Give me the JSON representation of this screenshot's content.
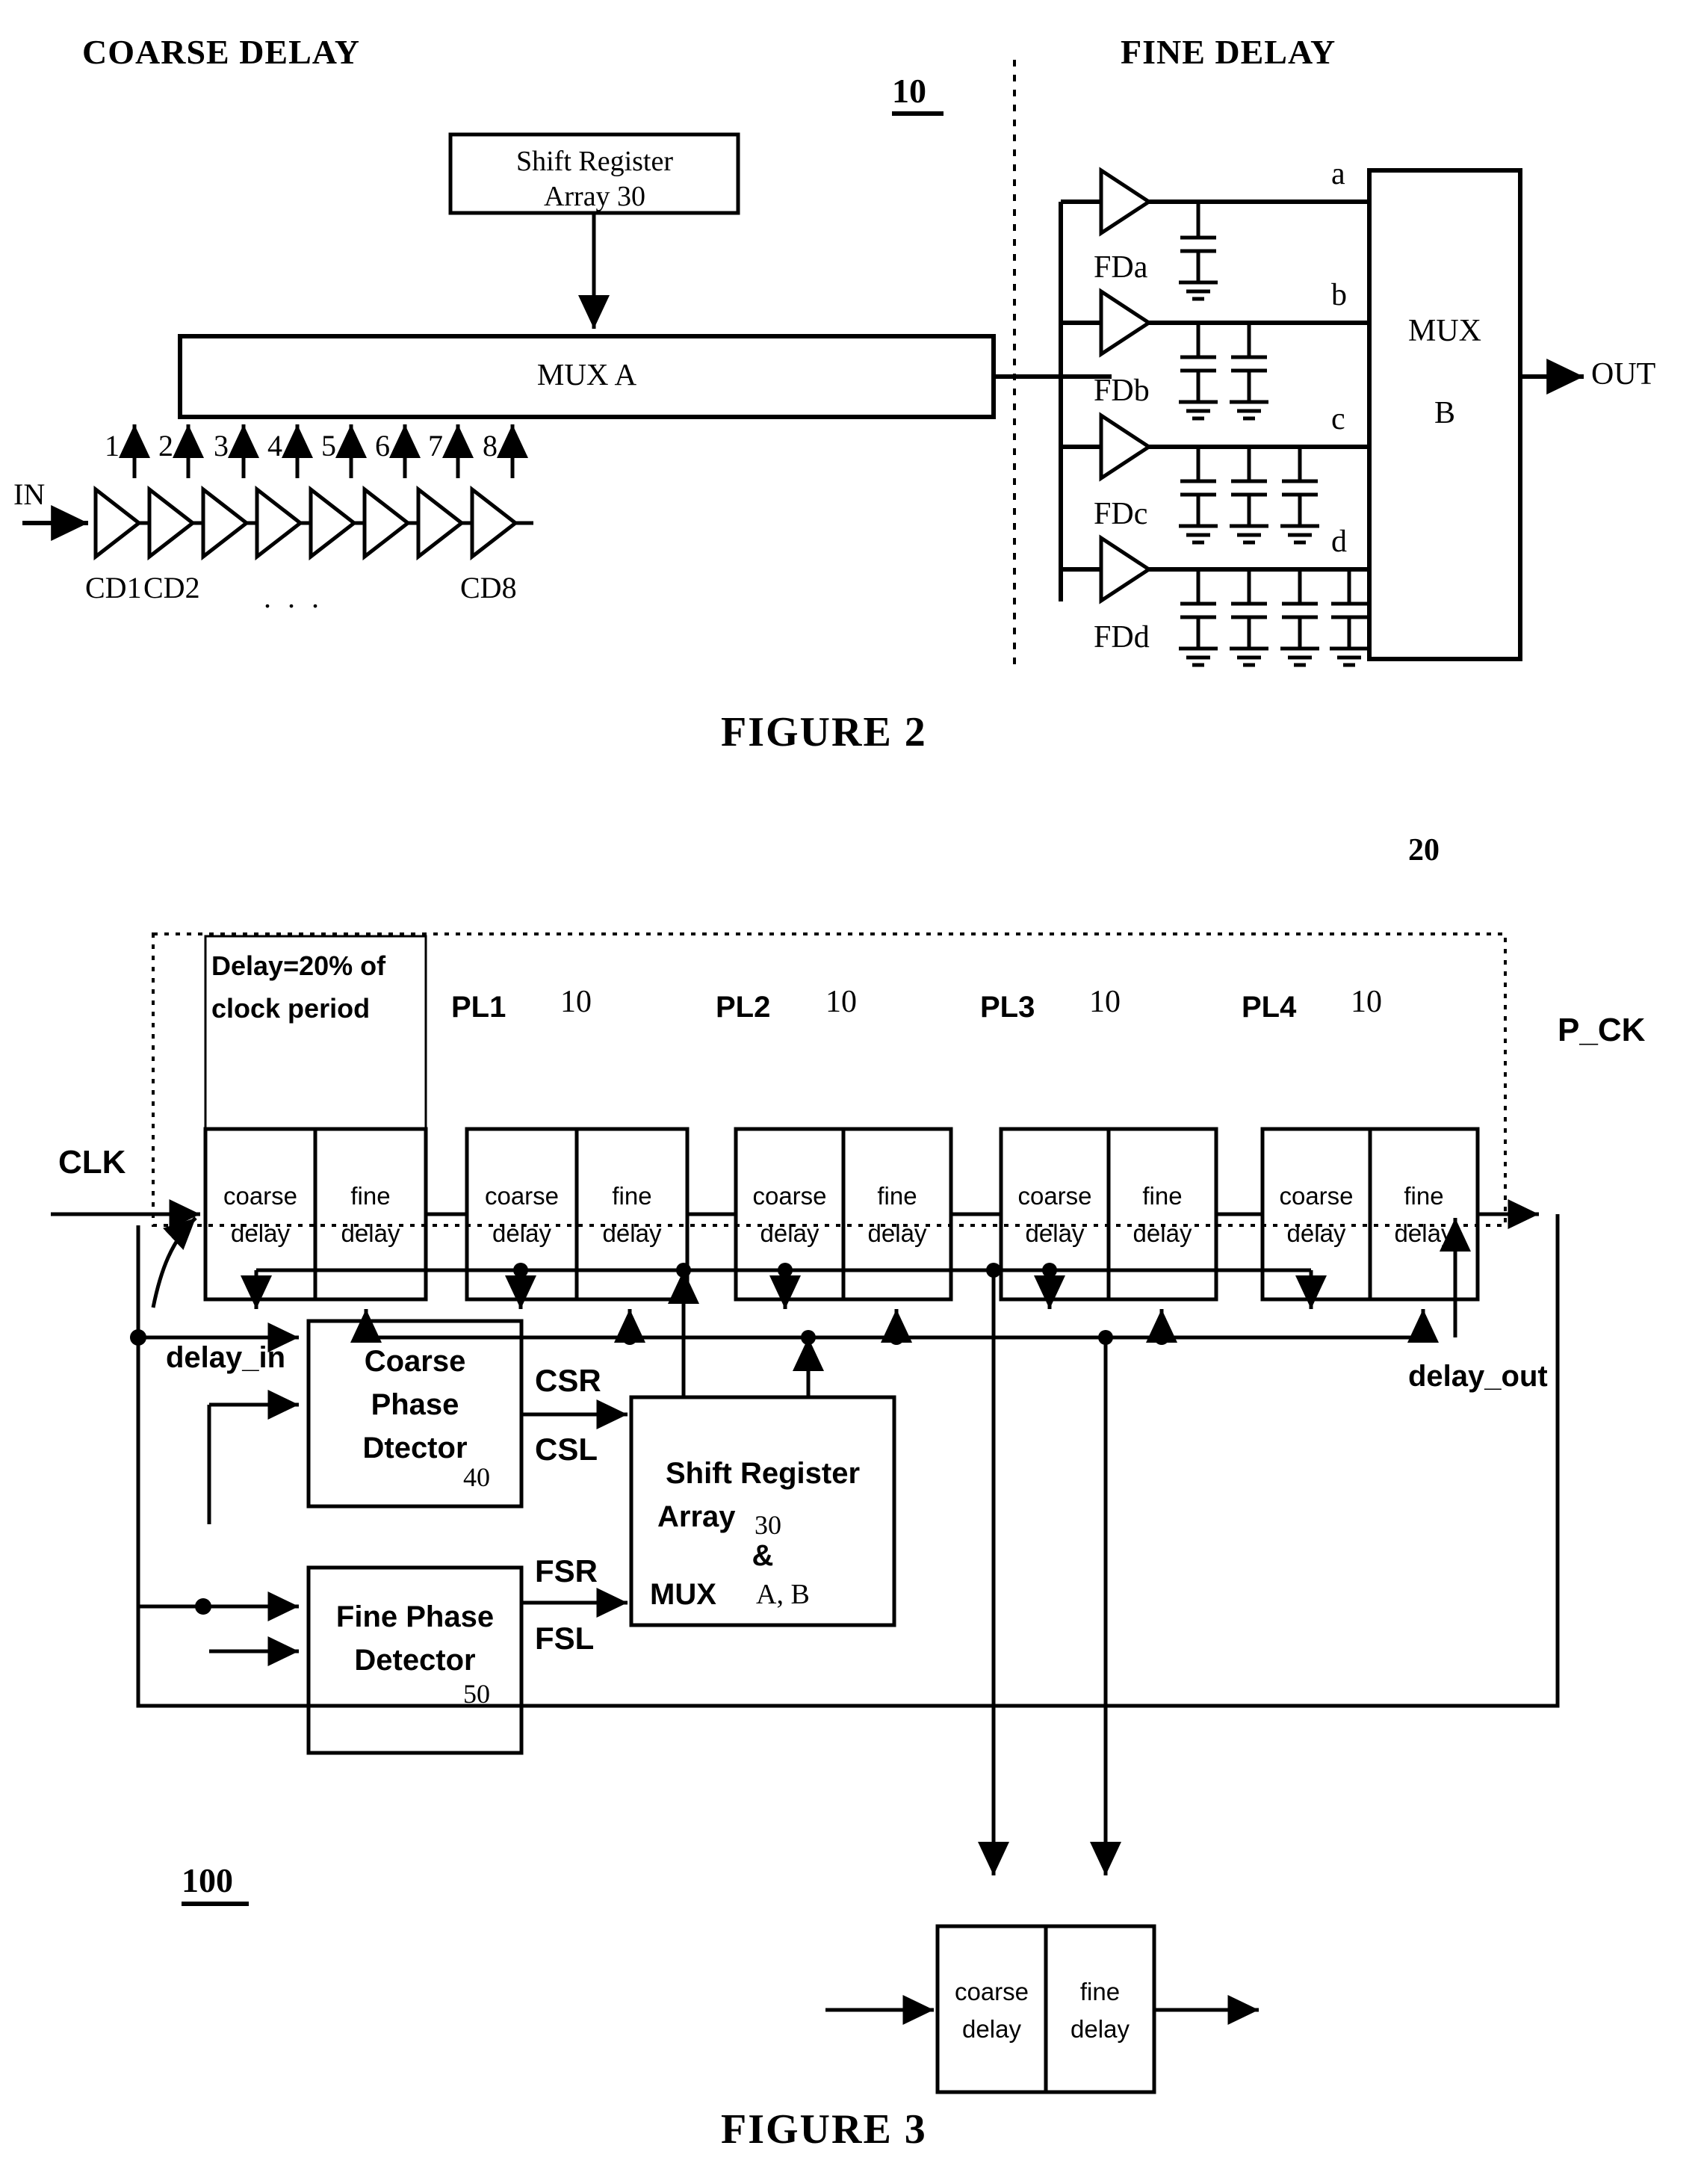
{
  "figure2": {
    "section_titles": {
      "coarse": "COARSE DELAY",
      "fine": "FINE DELAY"
    },
    "ref_numeral": "10",
    "shift_register_box": "Shift Register\nArray 30",
    "shift_register_line1": "Shift Register",
    "shift_register_line2": "Array 30",
    "mux_a_label": "MUX  A",
    "tap_numbers": [
      "1",
      "2",
      "3",
      "4",
      "5",
      "6",
      "7",
      "8"
    ],
    "input_label": "IN",
    "output_label": "OUT",
    "coarse_delay_cells": [
      "CD1",
      "CD2",
      "CD8"
    ],
    "ellipsis": ". . .",
    "fine_delay_cells": [
      {
        "name": "FDa",
        "tap": "a",
        "capacitors": 1
      },
      {
        "name": "FDb",
        "tap": "b",
        "capacitors": 2
      },
      {
        "name": "FDc",
        "tap": "c",
        "capacitors": 3
      },
      {
        "name": "FDd",
        "tap": "d",
        "capacitors": 4
      }
    ],
    "mux_b_line1": "MUX",
    "mux_b_line2": "B",
    "caption": "FIGURE 2"
  },
  "figure3": {
    "ref_numeral_top": "20",
    "ref_numeral_bottom": "100",
    "clk_label": "CLK",
    "pck_label": "P_CK",
    "delay_in_label": "delay_in",
    "delay_out_label": "delay_out",
    "first_stage_note_line1": "Delay=20% of",
    "first_stage_note_line2": "clock period",
    "stage_labels": [
      "PL1",
      "PL2",
      "PL3",
      "PL4"
    ],
    "stage_ref": "10",
    "coarse_cell_line1": "coarse",
    "coarse_cell_line2": "delay",
    "fine_cell_line1": "fine",
    "fine_cell_line2": "delay",
    "coarse_detector": {
      "line1": "Coarse",
      "line2": "Phase",
      "line3": "Dtector",
      "ref": "40",
      "out_top": "CSR",
      "out_bottom": "CSL"
    },
    "fine_detector": {
      "line1": "Fine Phase",
      "line2": "Detector",
      "ref": "50",
      "out_top": "FSR",
      "out_bottom": "FSL"
    },
    "shift_register_block": {
      "line1": "Shift Register",
      "line2": "Array",
      "line2_ref": "30",
      "line3": "&",
      "line4": "MUX",
      "line4_ref": "A, B"
    },
    "caption": "FIGURE 3"
  }
}
